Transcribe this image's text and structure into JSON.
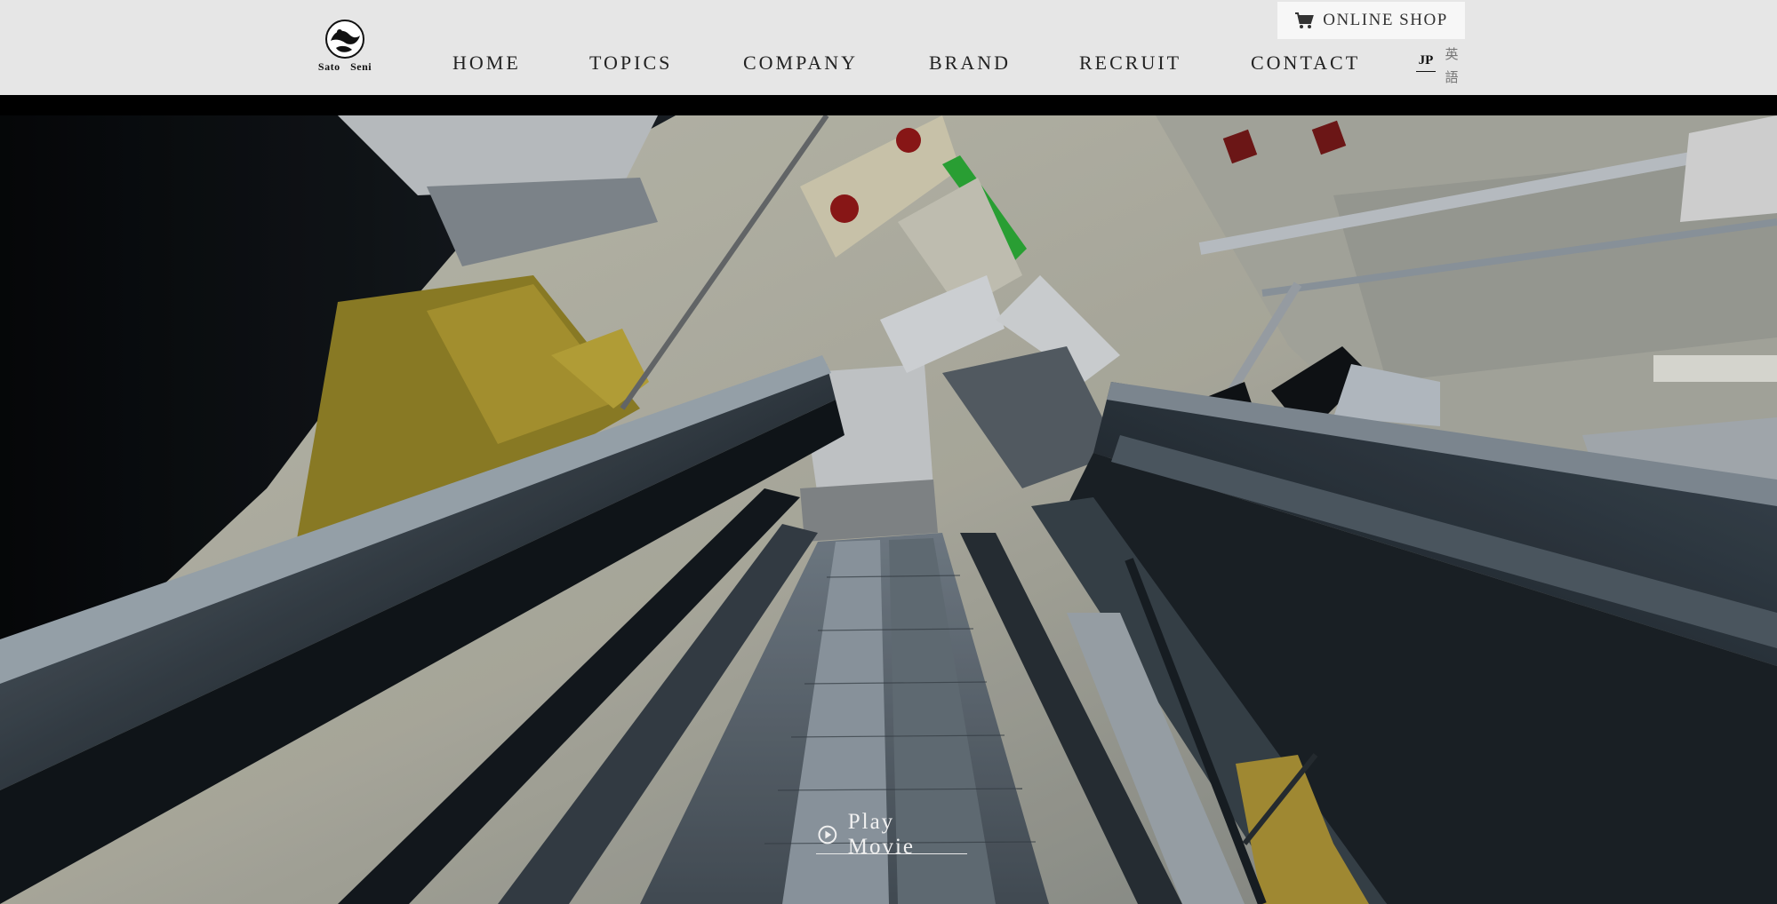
{
  "brand": {
    "logo_text": "Sato Seni"
  },
  "nav": {
    "items": [
      {
        "label": "HOME"
      },
      {
        "label": "TOPICS"
      },
      {
        "label": "COMPANY"
      },
      {
        "label": "BRAND"
      },
      {
        "label": "RECRUIT"
      },
      {
        "label": "CONTACT"
      }
    ]
  },
  "shop": {
    "label": "ONLINE SHOP",
    "icon": "cart-icon"
  },
  "language": {
    "jp": "JP",
    "en": "英語"
  },
  "hero": {
    "play_label": "Play Movie",
    "icon": "play-circle-icon"
  },
  "colors": {
    "header_bg": "#e6e6e6",
    "shop_bg": "#f7f7f7",
    "text_dark": "#222222"
  }
}
